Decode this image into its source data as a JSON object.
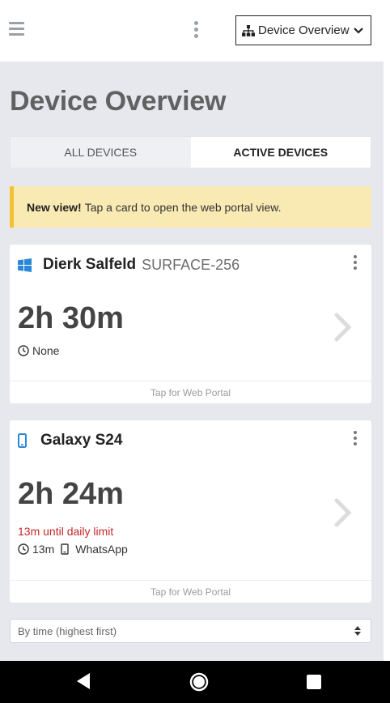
{
  "header": {
    "menu_icon": "hamburger-icon",
    "more_icon": "kebab-icon",
    "view_select": {
      "label": "Device Overview",
      "icon": "sitemap-icon",
      "chevron": "chevron-down-icon"
    }
  },
  "page": {
    "title": "Device Overview"
  },
  "tabs": [
    {
      "label": "ALL DEVICES",
      "active": false
    },
    {
      "label": "ACTIVE DEVICES",
      "active": true
    }
  ],
  "notice": {
    "bold": "New view!",
    "text": "Tap a card to open the web portal view."
  },
  "cards": [
    {
      "icon": "windows-icon",
      "name": "Dierk Salfeld",
      "device": "SURFACE-256",
      "time": "2h 30m",
      "limit_text": "",
      "clock_value": "None",
      "app": "",
      "footer": "Tap for Web Portal"
    },
    {
      "icon": "phone-icon",
      "name": "Galaxy S24",
      "device": "",
      "time": "2h 24m",
      "limit_text": "13m until daily limit",
      "clock_value": "13m",
      "app": "WhatsApp",
      "footer": "Tap for Web Portal"
    }
  ],
  "sort": {
    "value": "By time (highest first)"
  },
  "colors": {
    "accent_blue": "#2b88d8",
    "limit_red": "#c62828",
    "notice_bg": "#f8eab2",
    "notice_bar": "#f1c232",
    "page_bg": "#e6e8ee"
  },
  "system_nav": {
    "back": "back-icon",
    "home": "home-icon",
    "recents": "recents-icon"
  }
}
